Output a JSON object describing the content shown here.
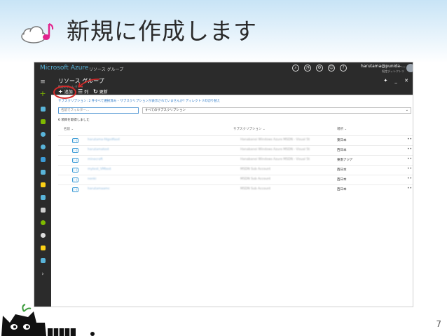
{
  "slide": {
    "title": "新規に作成します",
    "page_number": "7"
  },
  "portal": {
    "brand": "Microsoft Azure",
    "brand_sub": "リソース グループ",
    "user_name": "harutama@punida-...",
    "user_sub": "既定ディレクトリ",
    "blade_title": "リソース グループ",
    "blade_subtitle": "既定のディレクトリ",
    "commands": [
      {
        "icon": "+",
        "label": "追加"
      },
      {
        "icon": "☰",
        "label": "列"
      },
      {
        "icon": "↻",
        "label": "更新"
      }
    ],
    "notice": "サブスクリプション: 2 件すべて選択済み – サブスクリプションが表示されていませんか? ディレクトリの切り替え",
    "filter_placeholder": "名前でフィルター...",
    "subscription_select": "すべてのサブスクリプション",
    "item_count": "6 項目を取得しました",
    "columns": {
      "name": "名前",
      "subscription": "サブスクリプション",
      "location": "場所"
    },
    "rows": [
      {
        "name": "harutama-fdgsdfasd",
        "subscription": "Hanabanei Windows Azure MSDN - Visual St",
        "location": "東日本"
      },
      {
        "name": "harutamatest",
        "subscription": "Hanabanei Windows Azure MSDN - Visual St",
        "location": "西日本"
      },
      {
        "name": "minecraft",
        "subscription": "Hanabanei Windows Azure MSDN - Visual St",
        "location": "東南アジア"
      },
      {
        "name": "mytest_VMtest",
        "subscription": "MSDN Sub Account",
        "location": "西日本"
      },
      {
        "name": "nonki",
        "subscription": "MSDN Sub Account",
        "location": "西日本"
      },
      {
        "name": "harutamaamc",
        "subscription": "MSDN Sub Account",
        "location": "西日本"
      }
    ],
    "more_label": "•••"
  },
  "colors": {
    "azure_blue": "#59b4d9",
    "portal_dark": "#2b2b2b",
    "annotation_red": "#d42a2a"
  }
}
